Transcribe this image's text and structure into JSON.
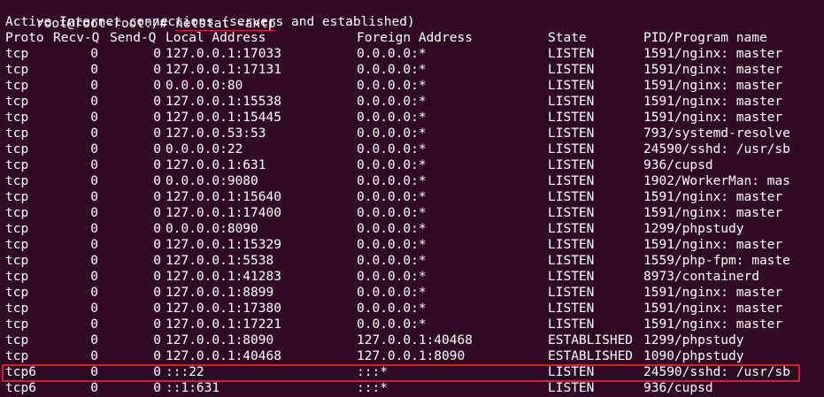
{
  "prompt": {
    "user_host": "root@root-root:/# ",
    "command": "netstat -antp"
  },
  "title": "Active Internet connections (servers and established)",
  "columns": {
    "proto": "Proto",
    "recv": "Recv-Q",
    "send": "Send-Q",
    "local": "Local Address",
    "foreign": "Foreign Address",
    "state": "State",
    "pid": "PID/Program name"
  },
  "rows": [
    {
      "proto": "tcp",
      "recv": "0",
      "send": "0",
      "local": "127.0.0.1:17033",
      "foreign": "0.0.0.0:*",
      "state": "LISTEN",
      "pid": "1591/nginx: master"
    },
    {
      "proto": "tcp",
      "recv": "0",
      "send": "0",
      "local": "127.0.0.1:17131",
      "foreign": "0.0.0.0:*",
      "state": "LISTEN",
      "pid": "1591/nginx: master"
    },
    {
      "proto": "tcp",
      "recv": "0",
      "send": "0",
      "local": "0.0.0.0:80",
      "foreign": "0.0.0.0:*",
      "state": "LISTEN",
      "pid": "1591/nginx: master"
    },
    {
      "proto": "tcp",
      "recv": "0",
      "send": "0",
      "local": "127.0.0.1:15538",
      "foreign": "0.0.0.0:*",
      "state": "LISTEN",
      "pid": "1591/nginx: master"
    },
    {
      "proto": "tcp",
      "recv": "0",
      "send": "0",
      "local": "127.0.0.1:15445",
      "foreign": "0.0.0.0:*",
      "state": "LISTEN",
      "pid": "1591/nginx: master"
    },
    {
      "proto": "tcp",
      "recv": "0",
      "send": "0",
      "local": "127.0.0.53:53",
      "foreign": "0.0.0.0:*",
      "state": "LISTEN",
      "pid": "793/systemd-resolve"
    },
    {
      "proto": "tcp",
      "recv": "0",
      "send": "0",
      "local": "0.0.0.0:22",
      "foreign": "0.0.0.0:*",
      "state": "LISTEN",
      "pid": "24590/sshd: /usr/sb"
    },
    {
      "proto": "tcp",
      "recv": "0",
      "send": "0",
      "local": "127.0.0.1:631",
      "foreign": "0.0.0.0:*",
      "state": "LISTEN",
      "pid": "936/cupsd"
    },
    {
      "proto": "tcp",
      "recv": "0",
      "send": "0",
      "local": "0.0.0.0:9080",
      "foreign": "0.0.0.0:*",
      "state": "LISTEN",
      "pid": "1902/WorkerMan: mas"
    },
    {
      "proto": "tcp",
      "recv": "0",
      "send": "0",
      "local": "127.0.0.1:15640",
      "foreign": "0.0.0.0:*",
      "state": "LISTEN",
      "pid": "1591/nginx: master"
    },
    {
      "proto": "tcp",
      "recv": "0",
      "send": "0",
      "local": "127.0.0.1:17400",
      "foreign": "0.0.0.0:*",
      "state": "LISTEN",
      "pid": "1591/nginx: master"
    },
    {
      "proto": "tcp",
      "recv": "0",
      "send": "0",
      "local": "0.0.0.0:8090",
      "foreign": "0.0.0.0:*",
      "state": "LISTEN",
      "pid": "1299/phpstudy"
    },
    {
      "proto": "tcp",
      "recv": "0",
      "send": "0",
      "local": "127.0.0.1:15329",
      "foreign": "0.0.0.0:*",
      "state": "LISTEN",
      "pid": "1591/nginx: master"
    },
    {
      "proto": "tcp",
      "recv": "0",
      "send": "0",
      "local": "127.0.0.1:5538",
      "foreign": "0.0.0.0:*",
      "state": "LISTEN",
      "pid": "1559/php-fpm: maste"
    },
    {
      "proto": "tcp",
      "recv": "0",
      "send": "0",
      "local": "127.0.0.1:41283",
      "foreign": "0.0.0.0:*",
      "state": "LISTEN",
      "pid": "8973/containerd"
    },
    {
      "proto": "tcp",
      "recv": "0",
      "send": "0",
      "local": "127.0.0.1:8899",
      "foreign": "0.0.0.0:*",
      "state": "LISTEN",
      "pid": "1591/nginx: master"
    },
    {
      "proto": "tcp",
      "recv": "0",
      "send": "0",
      "local": "127.0.0.1:17380",
      "foreign": "0.0.0.0:*",
      "state": "LISTEN",
      "pid": "1591/nginx: master"
    },
    {
      "proto": "tcp",
      "recv": "0",
      "send": "0",
      "local": "127.0.0.1:17221",
      "foreign": "0.0.0.0:*",
      "state": "LISTEN",
      "pid": "1591/nginx: master"
    },
    {
      "proto": "tcp",
      "recv": "0",
      "send": "0",
      "local": "127.0.0.1:8090",
      "foreign": "127.0.0.1:40468",
      "state": "ESTABLISHED",
      "pid": "1299/phpstudy"
    },
    {
      "proto": "tcp",
      "recv": "0",
      "send": "0",
      "local": "127.0.0.1:40468",
      "foreign": "127.0.0.1:8090",
      "state": "ESTABLISHED",
      "pid": "1090/phpstudy"
    },
    {
      "proto": "tcp6",
      "recv": "0",
      "send": "0",
      "local": ":::22",
      "foreign": ":::*",
      "state": "LISTEN",
      "pid": "24590/sshd: /usr/sb"
    },
    {
      "proto": "tcp6",
      "recv": "0",
      "send": "0",
      "local": "::1:631",
      "foreign": ":::*",
      "state": "LISTEN",
      "pid": "936/cupsd"
    }
  ],
  "colors": {
    "background": "#300a24",
    "text": "#ffffff",
    "highlight": "#e01b24"
  },
  "highlighted_row_index": 20
}
